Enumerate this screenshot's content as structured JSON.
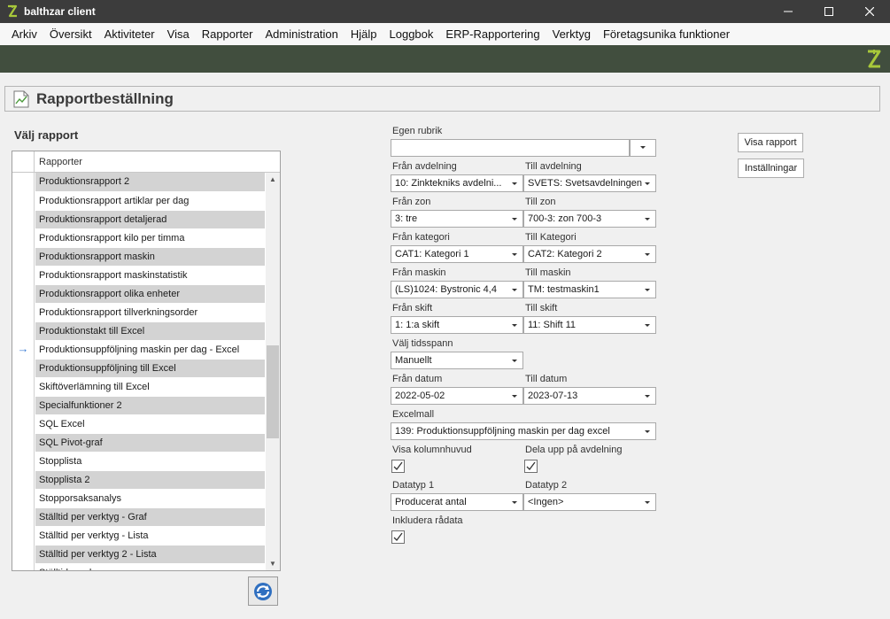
{
  "window": {
    "title": "balthzar client",
    "logo_icon": "balthzar-b-logo-icon"
  },
  "menu": [
    "Arkiv",
    "Översikt",
    "Aktiviteter",
    "Visa",
    "Rapporter",
    "Administration",
    "Hjälp",
    "Loggbok",
    "ERP-Rapportering",
    "Verktyg",
    "Företagsunika funktioner"
  ],
  "page": {
    "title": "Rapportbeställning",
    "choose_report": "Välj rapport"
  },
  "report_list": {
    "column_header": "Rapporter",
    "selected_index": 9,
    "rows": [
      "Produktionsrapport 2",
      "Produktionsrapport artiklar per dag",
      "Produktionsrapport detaljerad",
      "Produktionsrapport kilo per timma",
      "Produktionsrapport maskin",
      "Produktionsrapport maskinstatistik",
      "Produktionsrapport olika enheter",
      "Produktionsrapport tillverkningsorder",
      "Produktionstakt till Excel",
      "Produktionsuppföljning maskin per dag - Excel",
      "Produktionsuppföljning till Excel",
      "Skiftöverlämning till Excel",
      "Specialfunktioner 2",
      "SQL Excel",
      "SQL Pivot-graf",
      "Stopplista",
      "Stopplista 2",
      "Stopporsaksanalys",
      "Ställtid per verktyg - Graf",
      "Ställtid per verktyg - Lista",
      "Ställtid per verktyg 2 - Lista",
      "Ställtidsanalys"
    ]
  },
  "form": {
    "egen_rubrik": {
      "label": "Egen rubrik",
      "value": ""
    },
    "fran_avdelning": {
      "label": "Från avdelning",
      "value": "10: Zinktekniks avdelni..."
    },
    "till_avdelning": {
      "label": "Till avdelning",
      "value": "SVETS: Svetsavdelningen"
    },
    "fran_zon": {
      "label": "Från zon",
      "value": "3: tre"
    },
    "till_zon": {
      "label": "Till zon",
      "value": "700-3: zon 700-3"
    },
    "fran_kategori": {
      "label": "Från kategori",
      "value": "CAT1: Kategori 1"
    },
    "till_kategori": {
      "label": "Till Kategori",
      "value": "CAT2: Kategori 2"
    },
    "fran_maskin": {
      "label": "Från maskin",
      "value": "(LS)1024: Bystronic 4,4"
    },
    "till_maskin": {
      "label": "Till maskin",
      "value": "TM: testmaskin1"
    },
    "fran_skift": {
      "label": "Från skift",
      "value": "1: 1:a skift"
    },
    "till_skift": {
      "label": "Till skift",
      "value": "11: Shift 11"
    },
    "tidsspann": {
      "label": "Välj tidsspann",
      "value": "Manuellt"
    },
    "fran_datum": {
      "label": "Från datum",
      "value": "2022-05-02"
    },
    "till_datum": {
      "label": "Till datum",
      "value": "2023-07-13"
    },
    "excelmall": {
      "label": "Excelmall",
      "value": "139: Produktionsuppföljning maskin per dag excel"
    },
    "visa_kolumnhuvud": {
      "label": "Visa kolumnhuvud",
      "checked": true
    },
    "dela_upp": {
      "label": "Dela upp på avdelning",
      "checked": true
    },
    "datatyp1": {
      "label": "Datatyp 1",
      "value": "Producerat antal"
    },
    "datatyp2": {
      "label": "Datatyp 2",
      "value": "<Ingen>"
    },
    "inkludera_radata": {
      "label": "Inkludera rådata",
      "checked": true
    }
  },
  "buttons": {
    "visa_rapport": "Visa rapport",
    "installningar": "Inställningar"
  },
  "colors": {
    "titlebar": "#3c3c3c",
    "banner": "#414e3e",
    "logo_green": "#a8c83a",
    "row_alt": "#d3d3d3",
    "selection_arrow": "#3a7bd5"
  }
}
